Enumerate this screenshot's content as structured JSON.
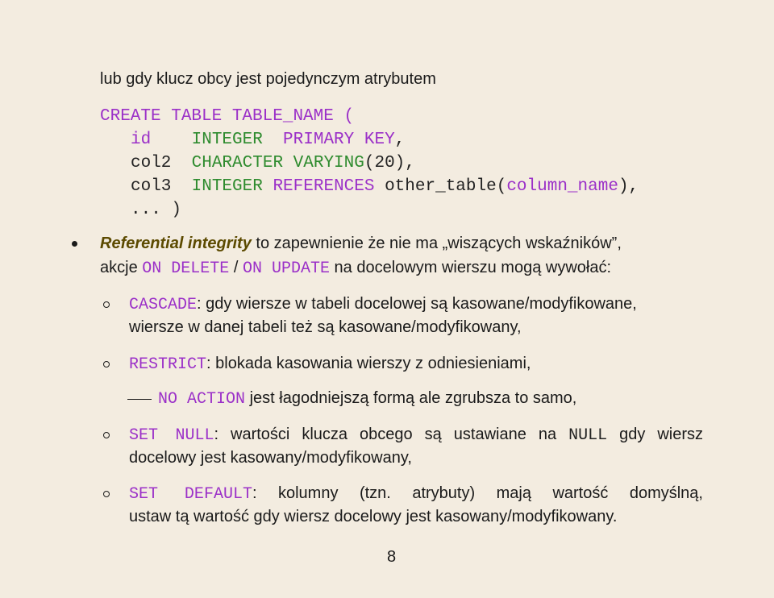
{
  "intro": "lub gdy klucz obcy jest pojedynczym atrybutem",
  "code": [
    [
      {
        "t": "CREATE TABLE TABLE_NAME (",
        "c": "p"
      }
    ],
    [
      {
        "t": "id    ",
        "c": "p"
      },
      {
        "t": "INTEGER  ",
        "c": "g"
      },
      {
        "t": "PRIMARY KEY",
        "c": "p"
      },
      {
        "t": ",",
        "c": "k"
      }
    ],
    [
      {
        "t": "col2  ",
        "c": "k"
      },
      {
        "t": "CHARACTER VARYING",
        "c": "g"
      },
      {
        "t": "(20),",
        "c": "k"
      }
    ],
    [
      {
        "t": "col3  ",
        "c": "k"
      },
      {
        "t": "INTEGER ",
        "c": "g"
      },
      {
        "t": "REFERENCES ",
        "c": "p"
      },
      {
        "t": "other_table(",
        "c": "k"
      },
      {
        "t": "column_name",
        "c": "p"
      },
      {
        "t": "),",
        "c": "k"
      }
    ],
    [
      {
        "t": "... )",
        "c": "k"
      }
    ]
  ],
  "main_bullet": {
    "line1": [
      {
        "t": "Referential integrity",
        "c": "em"
      },
      {
        "t": " to zapewnienie że nie ma „wiszących wskaźników”,",
        "c": "n"
      }
    ],
    "line2": [
      {
        "t": "akcje ",
        "c": "n"
      },
      {
        "t": "ON DELETE",
        "c": "kw"
      },
      {
        "t": " / ",
        "c": "n"
      },
      {
        "t": "ON UPDATE",
        "c": "kw"
      },
      {
        "t": " na docelowym wierszu mogą wywołać:",
        "c": "n"
      }
    ]
  },
  "options": [
    {
      "lines": [
        [
          {
            "t": "CASCADE",
            "c": "kw"
          },
          {
            "t": ": gdy wiersze w tabeli docelowej są kasowane/modyfikowane,",
            "c": "n"
          }
        ],
        [
          {
            "t": "wiersze w danej tabeli też są kasowane/modyfikowany,",
            "c": "n"
          }
        ]
      ]
    },
    {
      "lines": [
        [
          {
            "t": "RESTRICT",
            "c": "kw"
          },
          {
            "t": ": blokada kasowania wierszy z odniesieniami,",
            "c": "n"
          }
        ]
      ]
    },
    {
      "sub": true,
      "lines": [
        [
          {
            "t": "NO ACTION",
            "c": "kw"
          },
          {
            "t": " jest łagodniejszą formą ale zgrubsza to samo,",
            "c": "n"
          }
        ]
      ]
    },
    {
      "lines": [
        [
          {
            "t": "SET NULL",
            "c": "kw"
          },
          {
            "t": ": wartości klucza obcego są ustawiane na ",
            "c": "n"
          },
          {
            "t": "NULL",
            "c": "mp"
          },
          {
            "t": " gdy wiersz",
            "c": "n"
          }
        ],
        [
          {
            "t": "docelowy jest kasowany/modyfikowany,",
            "c": "n"
          }
        ]
      ]
    },
    {
      "lines": [
        [
          {
            "t": "SET DEFAULT",
            "c": "kw"
          },
          {
            "t": ": kolumny (tzn. atrybuty) mają wartość domyślną,",
            "c": "n"
          }
        ],
        [
          {
            "t": "ustaw tą wartość gdy wiersz docelowy jest kasowany/modyfikowany.",
            "c": "n"
          }
        ]
      ]
    }
  ],
  "page_number": "8",
  "colors": {
    "keyword_purple": "#9b30c8",
    "type_green": "#2e8b2e",
    "emphasis_olive": "#5c4a00",
    "background": "#f3ece0"
  }
}
